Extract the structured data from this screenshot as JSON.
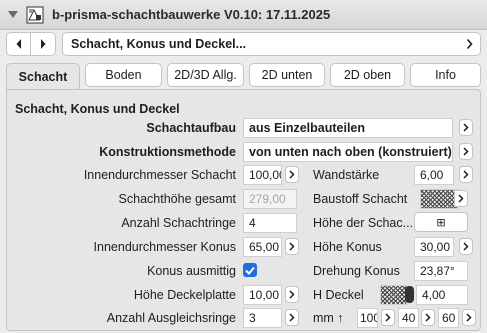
{
  "window": {
    "title": "b-prisma-schachtbauwerke V0.10: 17.11.2025"
  },
  "breadcrumb": {
    "label": "Schacht, Konus und Deckel..."
  },
  "tabs": [
    {
      "label": "Schacht",
      "active": true
    },
    {
      "label": "Boden"
    },
    {
      "label": "2D/3D Allg."
    },
    {
      "label": "2D unten"
    },
    {
      "label": "2D oben"
    },
    {
      "label": "Info"
    }
  ],
  "section": {
    "title": "Schacht, Konus und Deckel"
  },
  "rows": {
    "schachtaufbau": {
      "label": "Schachtaufbau",
      "value": "aus Einzelbauteilen"
    },
    "konstruktionsmethode": {
      "label": "Konstruktionsmethode",
      "value": "von unten nach oben (konstruiert)"
    },
    "innendurchmesser_schacht": {
      "label": "Innendurchmesser Schacht",
      "value": "100,00"
    },
    "wandstaerke": {
      "label": "Wandstärke",
      "value": "6,00"
    },
    "schachthoehe_gesamt": {
      "label": "Schachthöhe gesamt",
      "value": "279,00"
    },
    "baustoff_schacht": {
      "label": "Baustoff Schacht"
    },
    "anzahl_schachtringe": {
      "label": "Anzahl Schachtringe",
      "value": "4"
    },
    "hoehe_der_schacht": {
      "label": "Höhe der Schac...",
      "button": "⊞"
    },
    "innendurchmesser_konus": {
      "label": "Innendurchmesser Konus",
      "value": "65,00"
    },
    "hoehe_konus": {
      "label": "Höhe Konus",
      "value": "30,00"
    },
    "konus_ausmittig": {
      "label": "Konus ausmittig",
      "checked": true
    },
    "drehung_konus": {
      "label": "Drehung Konus",
      "value": "23,87°"
    },
    "hoehe_deckelplatte": {
      "label": "Höhe Deckelplatte",
      "value": "10,00"
    },
    "h_deckel": {
      "label": "H Deckel",
      "value": "4,00"
    },
    "anzahl_ausgleichsringe": {
      "label": "Anzahl Ausgleichsringe",
      "value": "3"
    },
    "mm": {
      "label": "mm ↑",
      "values": [
        "100",
        "40",
        "60"
      ]
    }
  },
  "colors": {
    "accent": "#1f6fde"
  },
  "icons": [
    "collapse-triangle-icon",
    "app-icon",
    "chevron-left-icon",
    "chevron-right-icon"
  ]
}
